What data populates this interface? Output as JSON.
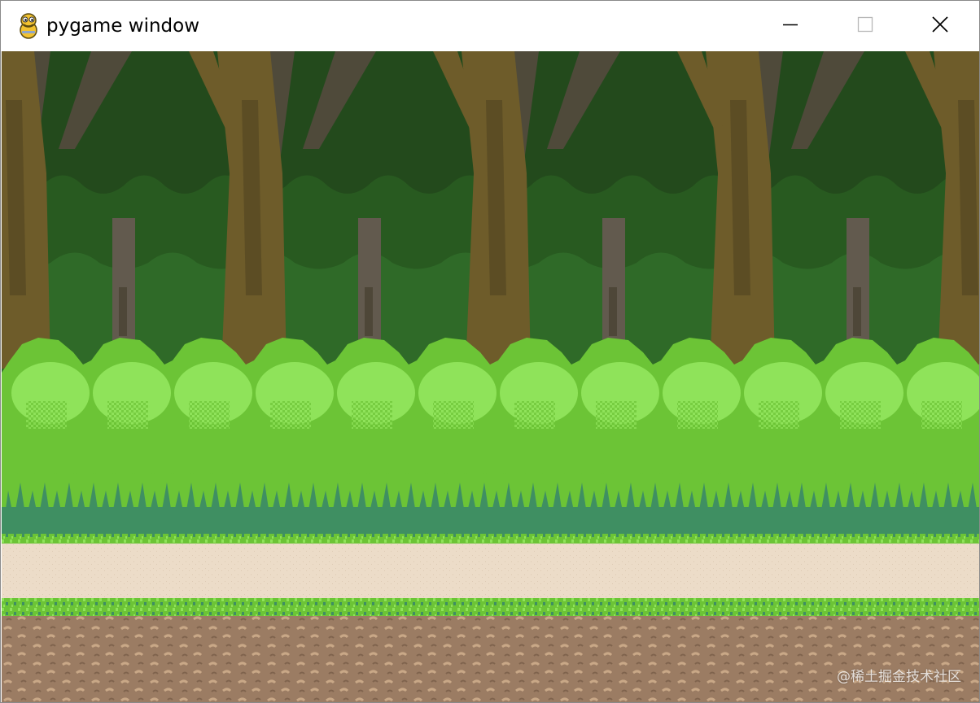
{
  "window": {
    "title": "pygame window",
    "app_icon": "pygame-snake-icon",
    "buttons": {
      "minimize": "minimize-icon",
      "maximize": "maximize-icon",
      "close": "close-icon"
    }
  },
  "game": {
    "scene": "pixel-art forest background",
    "watermark": "@稀土掘金技术社区"
  },
  "colors": {
    "canopy_dark": "#234a1c",
    "canopy_mid": "#2f6a28",
    "trunk": "#6e5c2a",
    "trunk_dark": "#4f4a3a",
    "bush_light": "#8fe35a",
    "bush_mid": "#6cc436",
    "grass_teal": "#3f8f62",
    "path": "#ecdcc8",
    "dirt": "#9b7c63"
  }
}
